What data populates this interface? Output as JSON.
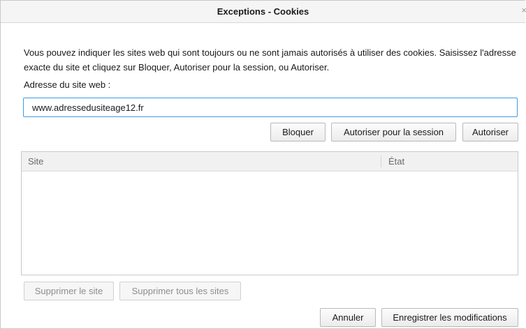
{
  "window": {
    "title": "Exceptions - Cookies",
    "close_glyph": "×"
  },
  "description": "Vous pouvez indiquer les sites web qui sont toujours ou ne sont jamais autorisés à utiliser des cookies. Saisissez l'adresse exacte du site et cliquez sur Bloquer, Autoriser pour la session, ou Autoriser.",
  "address": {
    "label": "Adresse du site web :",
    "value": "www.adressedusiteage12.fr"
  },
  "actions": {
    "block": "Bloquer",
    "allow_session": "Autoriser pour la session",
    "allow": "Autoriser"
  },
  "table": {
    "columns": [
      "Site",
      "État"
    ],
    "rows": []
  },
  "list_actions": {
    "remove_site": "Supprimer le site",
    "remove_all": "Supprimer tous les sites"
  },
  "footer": {
    "cancel": "Annuler",
    "save": "Enregistrer les modifications"
  },
  "colors": {
    "input_focus_border": "#3d9ae8",
    "titlebar_bg": "#f5f5f5"
  }
}
